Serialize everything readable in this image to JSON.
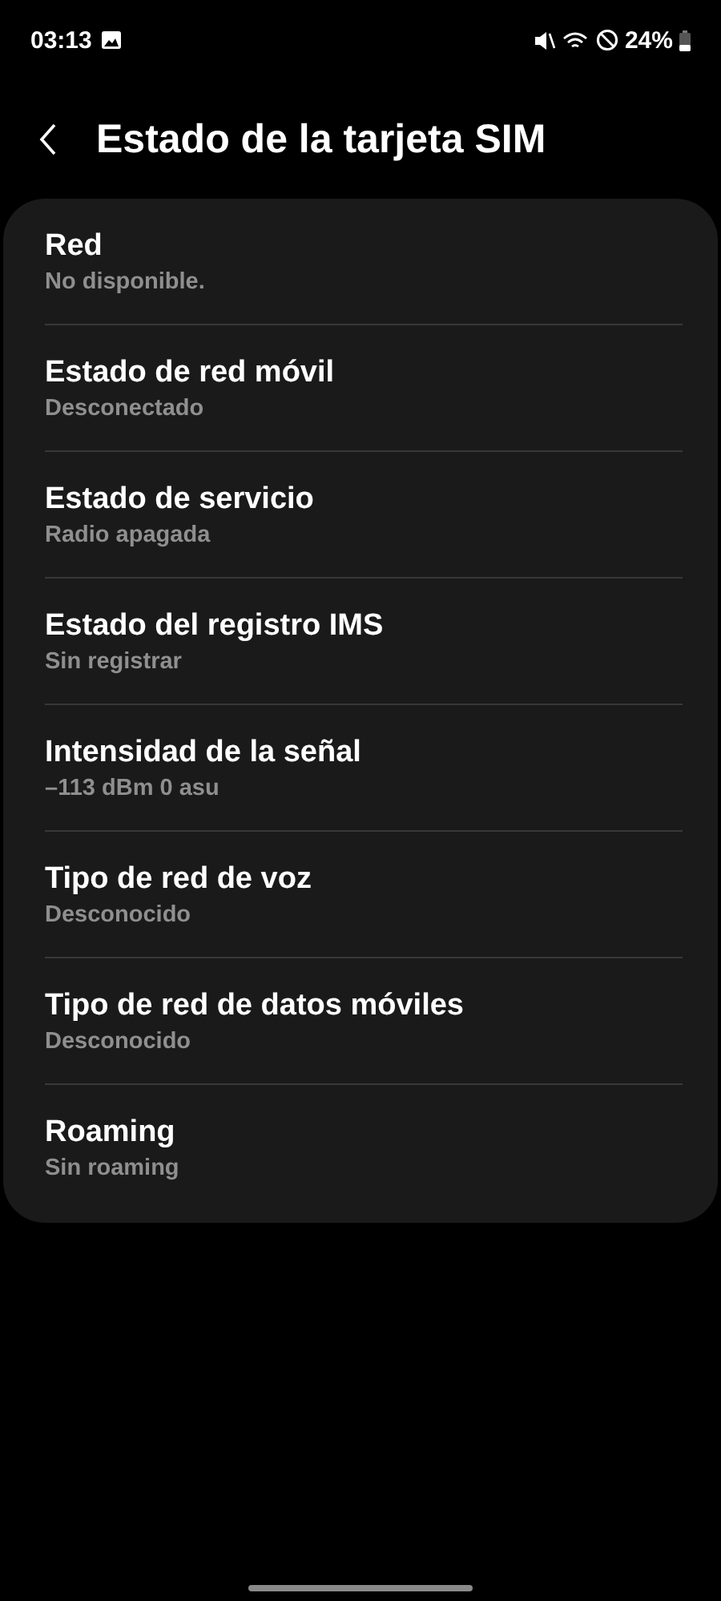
{
  "status_bar": {
    "time": "03:13",
    "battery": "24%"
  },
  "header": {
    "title": "Estado de la tarjeta SIM"
  },
  "items": [
    {
      "title": "Red",
      "value": "No disponible."
    },
    {
      "title": "Estado de red móvil",
      "value": "Desconectado"
    },
    {
      "title": "Estado de servicio",
      "value": "Radio apagada"
    },
    {
      "title": "Estado del registro IMS",
      "value": "Sin registrar"
    },
    {
      "title": "Intensidad de la señal",
      "value": "–113 dBm 0 asu"
    },
    {
      "title": "Tipo de red de voz",
      "value": "Desconocido"
    },
    {
      "title": "Tipo de red de datos móviles",
      "value": "Desconocido"
    },
    {
      "title": "Roaming",
      "value": "Sin roaming"
    }
  ]
}
